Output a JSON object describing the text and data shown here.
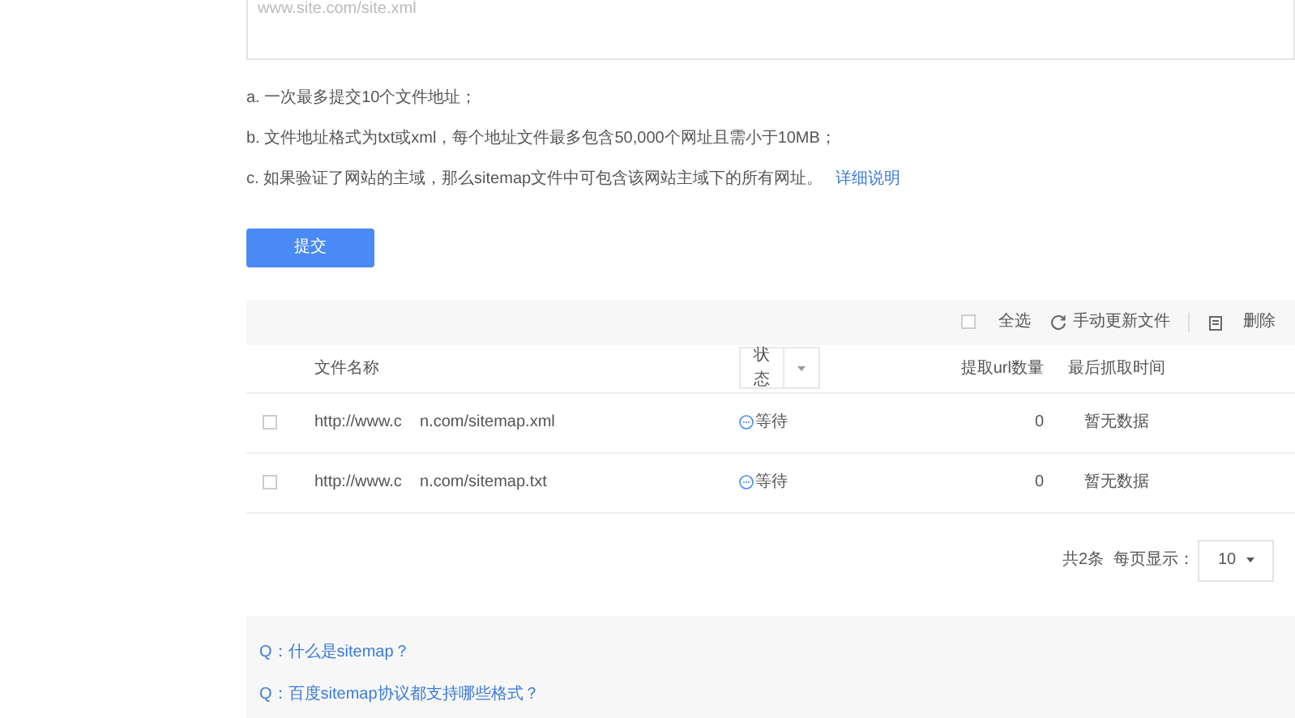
{
  "url_input": {
    "placeholder": "www.site.com/site.xml"
  },
  "notes": [
    {
      "text": "a. 一次最多提交10个文件地址；"
    },
    {
      "text": "b. 文件地址格式为txt或xml，每个地址文件最多包含50,000个网址且需小于10MB；"
    },
    {
      "text": "c. 如果验证了网站的主域，那么sitemap文件中可包含该网站主域下的所有网址。",
      "link": "详细说明"
    }
  ],
  "submit_button": "提交",
  "toolbar": {
    "select_all": {
      "label": "全选",
      "checked": false
    },
    "refresh": "手动更新文件",
    "delete": "删除"
  },
  "table": {
    "columns": [
      "文件名称",
      "状态",
      "提取url数量",
      "最后抓取时间"
    ],
    "rows": [
      {
        "checked": false,
        "file": "http://www.c    n.com/sitemap.xml",
        "status": "等待",
        "url_count": "0",
        "last_crawl": "暂无数据"
      },
      {
        "checked": false,
        "file": "http://www.c    n.com/sitemap.txt",
        "status": "等待",
        "url_count": "0",
        "last_crawl": "暂无数据"
      }
    ]
  },
  "pagination": {
    "total": "共2条",
    "per_page_label": "每页显示：",
    "per_page": "10"
  },
  "faq": [
    "Q：什么是sitemap？",
    "Q：百度sitemap协议都支持哪些格式？"
  ]
}
